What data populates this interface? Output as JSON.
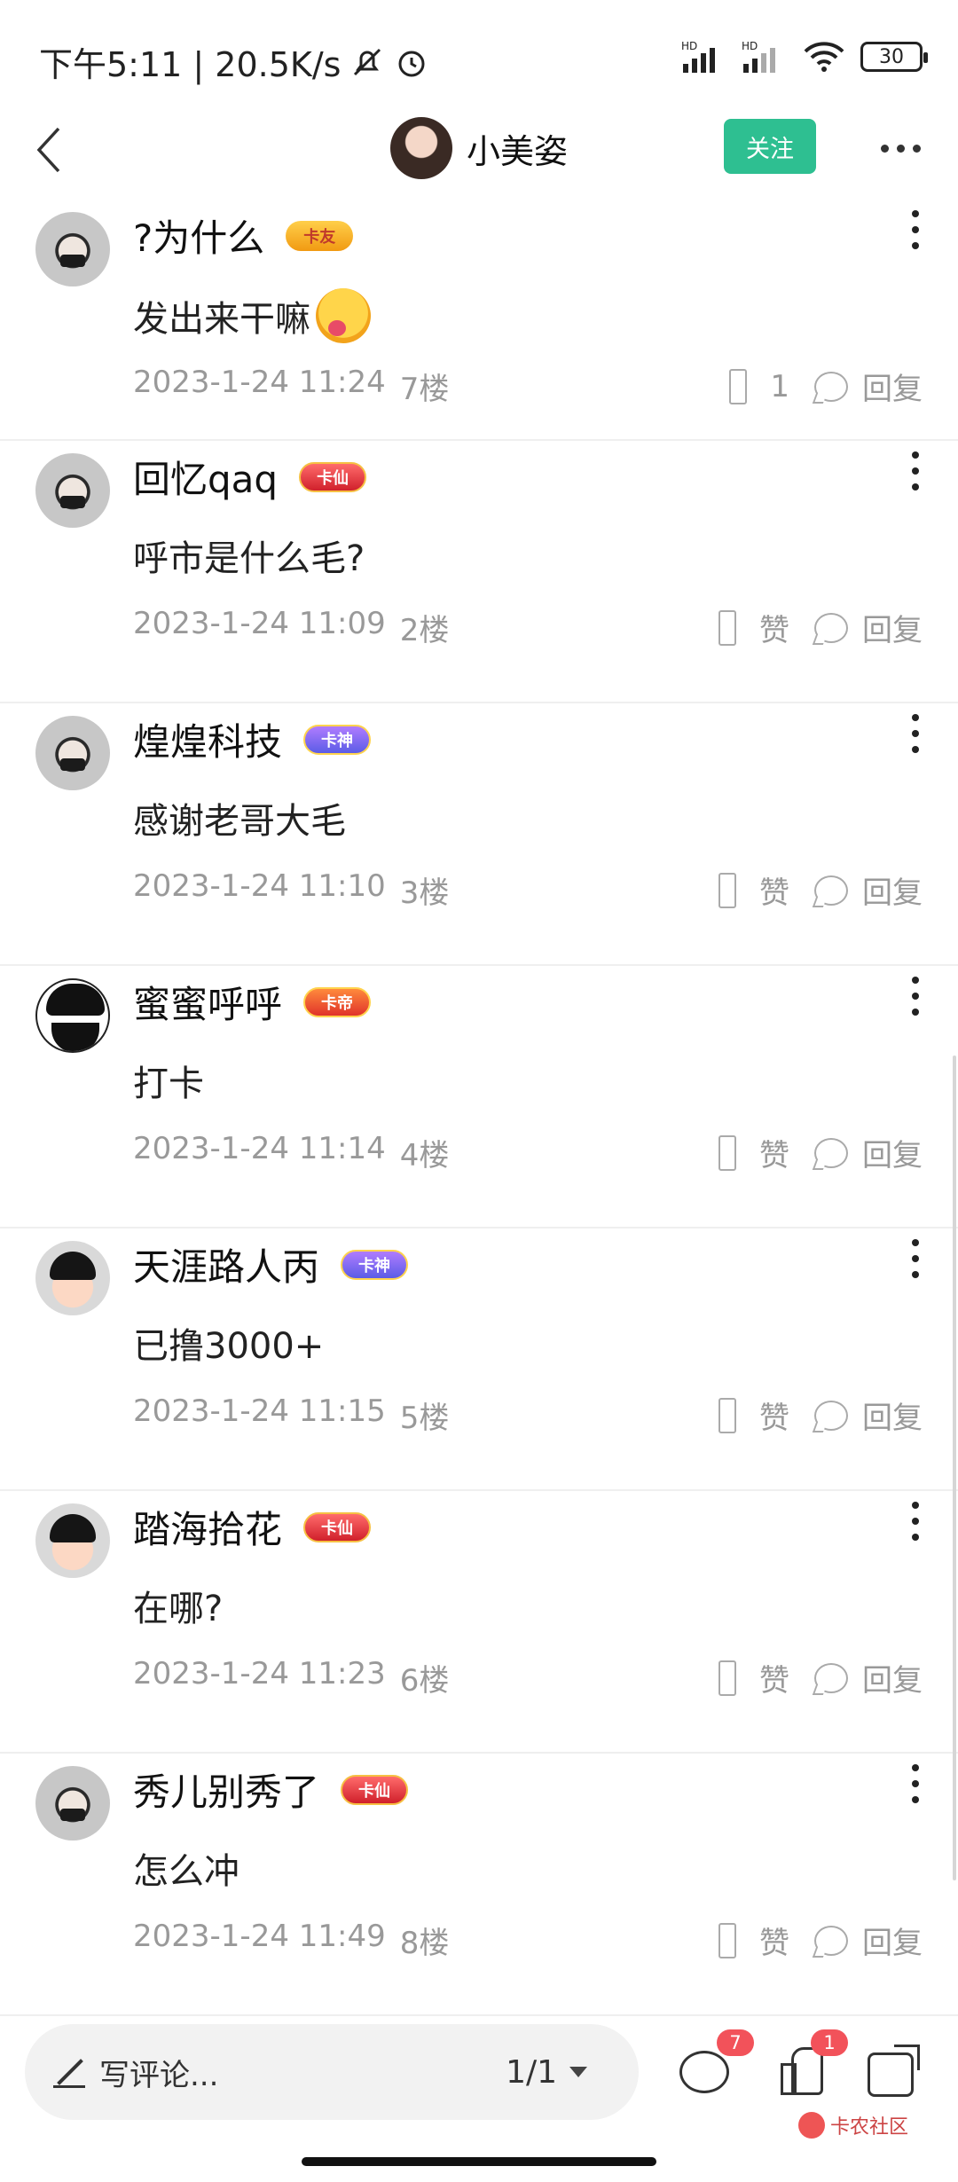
{
  "status_bar": {
    "time_speed": "下午5:11 | 20.5K/s",
    "signal_label_1": "HD",
    "signal_label_2": "HD",
    "battery": "30"
  },
  "header": {
    "username": "小美姿",
    "follow_label": "关注"
  },
  "comments": [
    {
      "name": "?为什么",
      "badge": "卡友",
      "badge_style": "gold",
      "avatar": "mask",
      "text": "发出来干嘛",
      "has_emoji": true,
      "date": "2023-1-24 11:24",
      "floor": "7楼",
      "like_label": "1",
      "reply_label": "回复"
    },
    {
      "name": "回忆qaq",
      "badge": "卡仙",
      "badge_style": "red",
      "avatar": "mask",
      "text": "呼市是什么毛?",
      "date": "2023-1-24 11:09",
      "floor": "2楼",
      "like_label": "赞",
      "reply_label": "回复"
    },
    {
      "name": "煌煌科技",
      "badge": "卡神",
      "badge_style": "purple",
      "avatar": "mask",
      "text": "感谢老哥大毛",
      "date": "2023-1-24 11:10",
      "floor": "3楼",
      "like_label": "赞",
      "reply_label": "回复"
    },
    {
      "name": "蜜蜜呼呼",
      "badge": "卡帝",
      "badge_style": "orange",
      "avatar": "beard",
      "text": "打卡",
      "date": "2023-1-24 11:14",
      "floor": "4楼",
      "like_label": "赞",
      "reply_label": "回复"
    },
    {
      "name": "天涯路人丙",
      "badge": "卡神",
      "badge_style": "purple",
      "avatar": "kid",
      "text": "已撸3000+",
      "date": "2023-1-24 11:15",
      "floor": "5楼",
      "like_label": "赞",
      "reply_label": "回复"
    },
    {
      "name": "踏海拾花",
      "badge": "卡仙",
      "badge_style": "red",
      "avatar": "kid",
      "text": "在哪?",
      "date": "2023-1-24 11:23",
      "floor": "6楼",
      "like_label": "赞",
      "reply_label": "回复"
    },
    {
      "name": "秀儿别秀了",
      "badge": "卡仙",
      "badge_style": "red",
      "avatar": "mask",
      "text": "怎么冲",
      "date": "2023-1-24 11:49",
      "floor": "8楼",
      "like_label": "赞",
      "reply_label": "回复"
    }
  ],
  "bottom_bar": {
    "write_placeholder": "写评论...",
    "page_indicator": "1/1",
    "comment_count": "7",
    "like_count": "1"
  },
  "watermark": "卡农社区",
  "colors": {
    "accent": "#2ebf91",
    "badge_red": "#f2525a",
    "meta_gray": "#999999"
  }
}
